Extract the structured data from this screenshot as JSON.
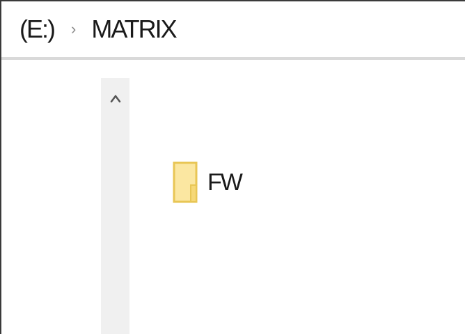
{
  "breadcrumb": {
    "drive": "(E:)",
    "separator": "›",
    "folder": "MATRIX"
  },
  "scrollbar": {
    "up_icon": "chevron-up-icon"
  },
  "files": [
    {
      "name": "FW",
      "icon": "folder-icon",
      "color": "#f8df8e"
    }
  ],
  "colors": {
    "folder_fill": "#fbe7a1",
    "folder_edge": "#e8c655",
    "scroll_track": "#f0f0f0",
    "divider": "#d9d9d9"
  }
}
